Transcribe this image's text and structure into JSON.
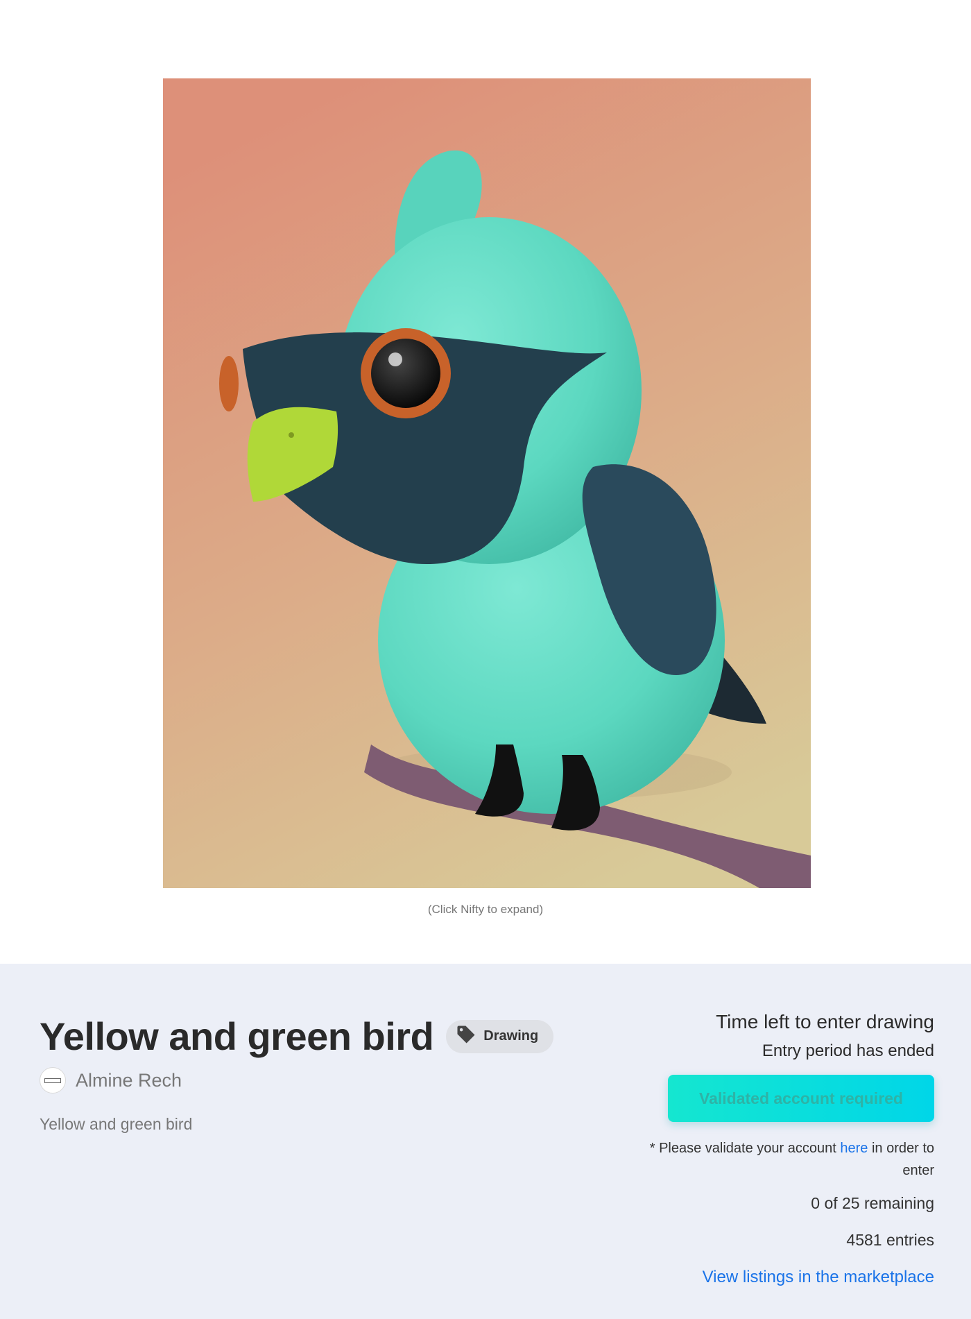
{
  "artwork": {
    "caption": "(Click Nifty to expand)",
    "colors": {
      "bg_top": "#dd9079",
      "bg_bottom": "#d8ca98",
      "body": "#5cd8c0",
      "mask": "#233f4d",
      "beak": "#b0d838",
      "eye_ring": "#c8622a",
      "branch": "#7e5c72"
    }
  },
  "drop": {
    "title": "Yellow and green bird",
    "tag": {
      "label": "Drawing",
      "icon": "tag-icon"
    },
    "artist": {
      "name": "Almine Rech",
      "avatar": "artist-logo"
    },
    "description": "Yellow and green bird"
  },
  "entry": {
    "time_label": "Time left to enter drawing",
    "status": "Entry period has ended",
    "button_label": "Validated account required",
    "note_prefix": "* Please validate your account ",
    "note_link": "here",
    "note_suffix": " in order to enter",
    "remaining": "0 of 25 remaining",
    "entries": "4581 entries",
    "marketplace_link": "View listings in the marketplace"
  },
  "theme": {
    "panel_bg": "#eceff7",
    "button_gradient_start": "#15e6d0",
    "button_gradient_end": "#00d6e8",
    "link": "#1a73e8"
  }
}
